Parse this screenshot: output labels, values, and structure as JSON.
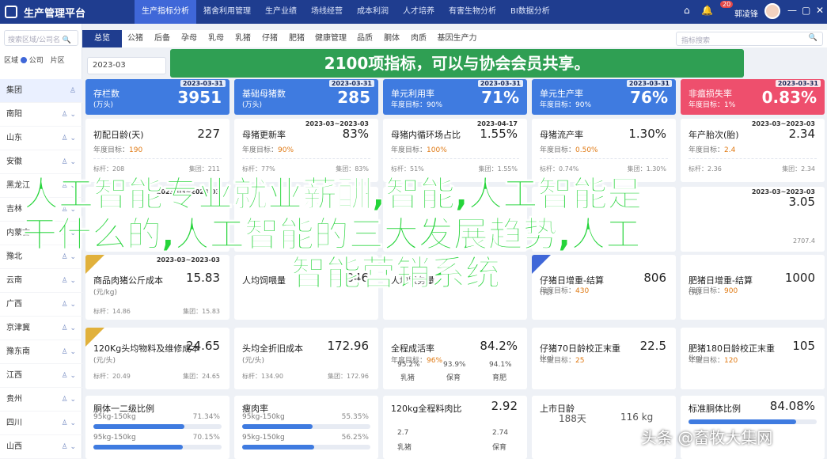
{
  "app": {
    "title": "生产管理平台"
  },
  "nav": [
    "生产指标分析",
    "猪舍利用管理",
    "生产业绩",
    "场线经营",
    "成本利润",
    "人才培养",
    "有害生物分析",
    "BI数据分析"
  ],
  "header": {
    "badge": "20",
    "user": "郭凌锋"
  },
  "sidebar": {
    "search_placeholder": "搜索区域/公司名",
    "filter": {
      "label": "区域",
      "option1": "公司",
      "option2": "片区"
    },
    "items": [
      "集团",
      "南阳",
      "山东",
      "安徽",
      "黑龙江",
      "吉林",
      "内蒙古",
      "豫北",
      "云南",
      "广西",
      "京津冀",
      "豫东南",
      "江西",
      "贵州",
      "四川",
      "山西"
    ]
  },
  "subtabs": [
    "总览",
    "公猪",
    "后备",
    "孕母",
    "乳母",
    "乳猪",
    "仔猪",
    "肥猪",
    "健康管理",
    "品质",
    "胴体",
    "肉质",
    "基因生产力"
  ],
  "subsearch_placeholder": "指标搜索",
  "date": "2023-03",
  "banner": "2100项指标，可以与协会会员共享。",
  "stat_cards": [
    {
      "title": "存栏数",
      "sub": "(万头)",
      "value": "3951",
      "date": "2023-03-31",
      "color": "#3f7be0"
    },
    {
      "title": "基础母猪数",
      "sub": "(万头)",
      "value": "285",
      "date": "2023-03-31",
      "color": "#3f7be0"
    },
    {
      "title": "单元利用率",
      "sub": "年度目标：90%",
      "value": "71%",
      "date": "2023-03-31",
      "color": "#3f7be0"
    },
    {
      "title": "单元生产率",
      "sub": "年度目标：90%",
      "value": "76%",
      "date": "2023-03-31",
      "color": "#3f7be0"
    },
    {
      "title": "非瘟损失率",
      "sub": "年度目标：1%",
      "value": "0.83%",
      "date": "2023-03-31",
      "color": "#ee4f6d"
    }
  ],
  "metrics_row1": [
    {
      "title": "初配日龄",
      "unit": "(天)",
      "value": "227",
      "target_label": "年度目标：",
      "target": "190",
      "foot": "标杆：208",
      "foot2": "集团：211"
    },
    {
      "title": "母猪更新率",
      "value": "83%",
      "date": "2023-03~2023-03",
      "target_label": "年度目标：",
      "target": "90%",
      "foot": "标杆：77%",
      "foot2": "集团：83%"
    },
    {
      "title": "母猪内循环场占比",
      "value": "1.55%",
      "date": "2023-04-17",
      "target_label": "年度目标：",
      "target": "100%",
      "foot": "标杆：51%",
      "foot2": "集团：1.55%"
    },
    {
      "title": "母猪流产率",
      "value": "1.30%",
      "target_label": "年度目标：",
      "target": "0.50%",
      "foot": "标杆：0.74%",
      "foot2": "集团：1.30%"
    },
    {
      "title": "年产胎次",
      "unit": "(胎)",
      "value": "2.34",
      "date": "2023-03~2023-03",
      "target_label": "年度目标：",
      "target": "2.4",
      "foot": "标杆：2.36",
      "foot2": "集团：2.34"
    }
  ],
  "metrics_row2": [
    {
      "title": "",
      "value": "",
      "date": "2023-03~2023-03"
    },
    {
      "title": "",
      "value": "",
      "date": ""
    },
    {
      "title": "",
      "value": "",
      "date": ""
    },
    {
      "title": "",
      "value": "",
      "date": ""
    },
    {
      "title": "",
      "value": "3.05",
      "date": "2023-03~2023-03"
    }
  ],
  "row2_extra": {
    "last": "2707.4",
    "last_label": "2707.4"
  },
  "metrics_row3": [
    {
      "title": "商品肉猪公斤成本",
      "unit": "(元/kg)",
      "value": "15.83",
      "foot": "标杆：14.86",
      "foot2": "集团：15.83",
      "date": "2023-03~2023-03"
    },
    {
      "title": "人均饲喂量",
      "value": "846"
    },
    {
      "title": "人均服务量",
      "value": ""
    },
    {
      "title": "仔猪日增重-结算",
      "unit": "(克)",
      "value": "806",
      "target_label": "年度目标：",
      "target": "430"
    },
    {
      "title": "肥猪日增重-结算",
      "unit": "(克)",
      "value": "1000",
      "target_label": "年度目标：",
      "target": "900"
    }
  ],
  "metrics_row4": [
    {
      "title": "120Kg头均物料及维修成本",
      "unit": "(元/头)",
      "value": "24.65",
      "foot": "标杆：20.49",
      "foot2": "集团：24.65"
    },
    {
      "title": "头均全折旧成本",
      "unit": "(元/头)",
      "value": "172.96",
      "foot": "标杆：134.90",
      "foot2": "集团：172.96"
    },
    {
      "title": "全程成活率",
      "target_label": "年度目标：",
      "target": "96%",
      "value": "84.2%",
      "vals": [
        "95.2%",
        "93.9%",
        "94.1%"
      ],
      "lbls": [
        "乳猪",
        "保育",
        "育肥"
      ]
    },
    {
      "title": "仔猪70日龄校正末重",
      "unit": "(kg)",
      "value": "22.5",
      "target_label": "年度目标：",
      "target": "25"
    },
    {
      "title": "肥猪180日龄校正末重",
      "unit": "(kg)",
      "value": "105",
      "target_label": "年度目标：",
      "target": "120"
    }
  ],
  "metrics_row5": [
    {
      "title": "胴体一二级比例",
      "l1": "95kg-150kg",
      "v1": "71.34%",
      "l2": "95kg-150kg",
      "v2": "70.15%",
      "p1": 0.71,
      "p2": 0.7
    },
    {
      "title": "瘦肉率",
      "l1": "95kg-150kg",
      "v1": "55.35%",
      "l2": "95kg-150kg",
      "v2": "56.25%",
      "p1": 0.55,
      "p2": 0.56
    },
    {
      "title": "120kg全程料肉比",
      "value": "2.92",
      "vals": [
        "2.7",
        "2.74"
      ],
      "lbls": [
        "乳猪",
        "保育"
      ]
    },
    {
      "title": "上市日龄",
      "a": "188天",
      "b": "116 kg"
    },
    {
      "title": "标准胴体比例",
      "value": "84.08%",
      "p": 0.84
    }
  ],
  "overlay": {
    "line1": "人工智能专业就业薪酬,智能,人工智能是",
    "line2": "干什么的,人工智能的三大发展趋势,人工",
    "line3": "智能营销系统"
  },
  "watermark": "头条 @畜牧大集网"
}
